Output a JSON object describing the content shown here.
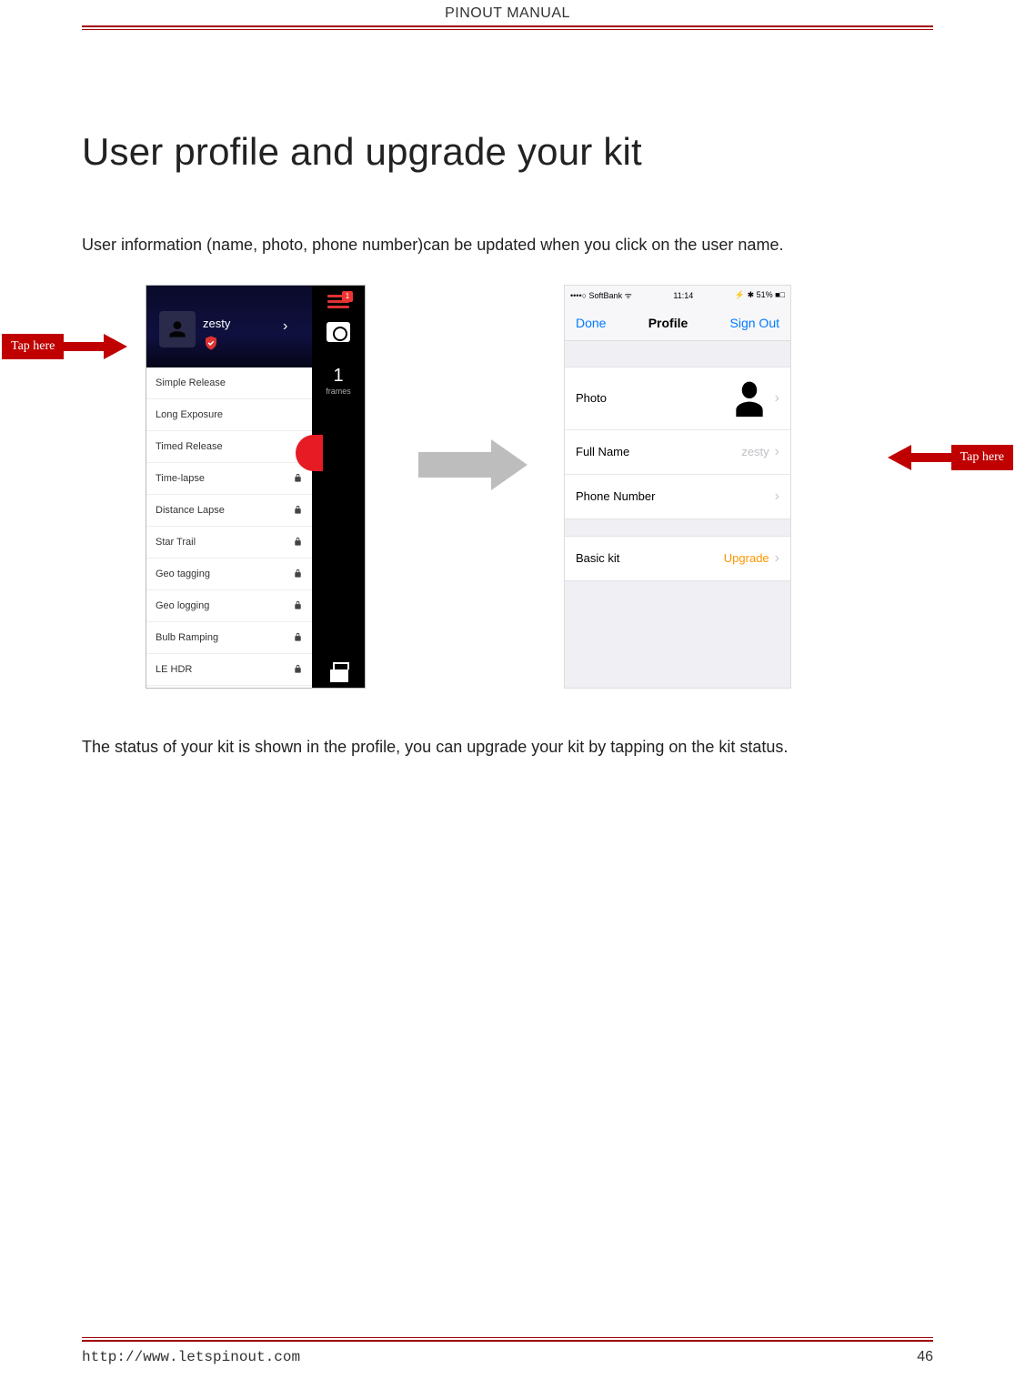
{
  "header": {
    "title": "PINOUT MANUAL"
  },
  "h1": "User profile and upgrade your kit",
  "para1": "User information (name, photo, phone number)can be updated when you click on the user name.",
  "para2": "The status of your kit is shown in the profile, you can upgrade your kit by tapping on the kit status.",
  "callout_left": "Tap here",
  "callout_right": "Tap here",
  "phone1": {
    "username": "zesty",
    "menu_badge": "1",
    "frames_count": "1",
    "frames_label": "frames",
    "list": [
      {
        "label": "Simple Release",
        "locked": false
      },
      {
        "label": "Long Exposure",
        "locked": false
      },
      {
        "label": "Timed Release",
        "locked": false
      },
      {
        "label": "Time-lapse",
        "locked": true
      },
      {
        "label": "Distance Lapse",
        "locked": true
      },
      {
        "label": "Star Trail",
        "locked": true
      },
      {
        "label": "Geo tagging",
        "locked": true
      },
      {
        "label": "Geo logging",
        "locked": true
      },
      {
        "label": "Bulb Ramping",
        "locked": true
      },
      {
        "label": "LE HDR",
        "locked": true
      }
    ]
  },
  "phone2": {
    "status_left": "••••○ SoftBank ᯤ",
    "status_time": "11:14",
    "status_right": "⚡ ✱ 51% ■□",
    "nav_done": "Done",
    "nav_title": "Profile",
    "nav_signout": "Sign Out",
    "rows": {
      "photo_label": "Photo",
      "fullname_label": "Full Name",
      "fullname_value": "zesty",
      "phone_label": "Phone Number",
      "kit_label": "Basic kit",
      "kit_action": "Upgrade"
    }
  },
  "footer": {
    "url": "http://www.letspinout.com",
    "page": "46"
  }
}
